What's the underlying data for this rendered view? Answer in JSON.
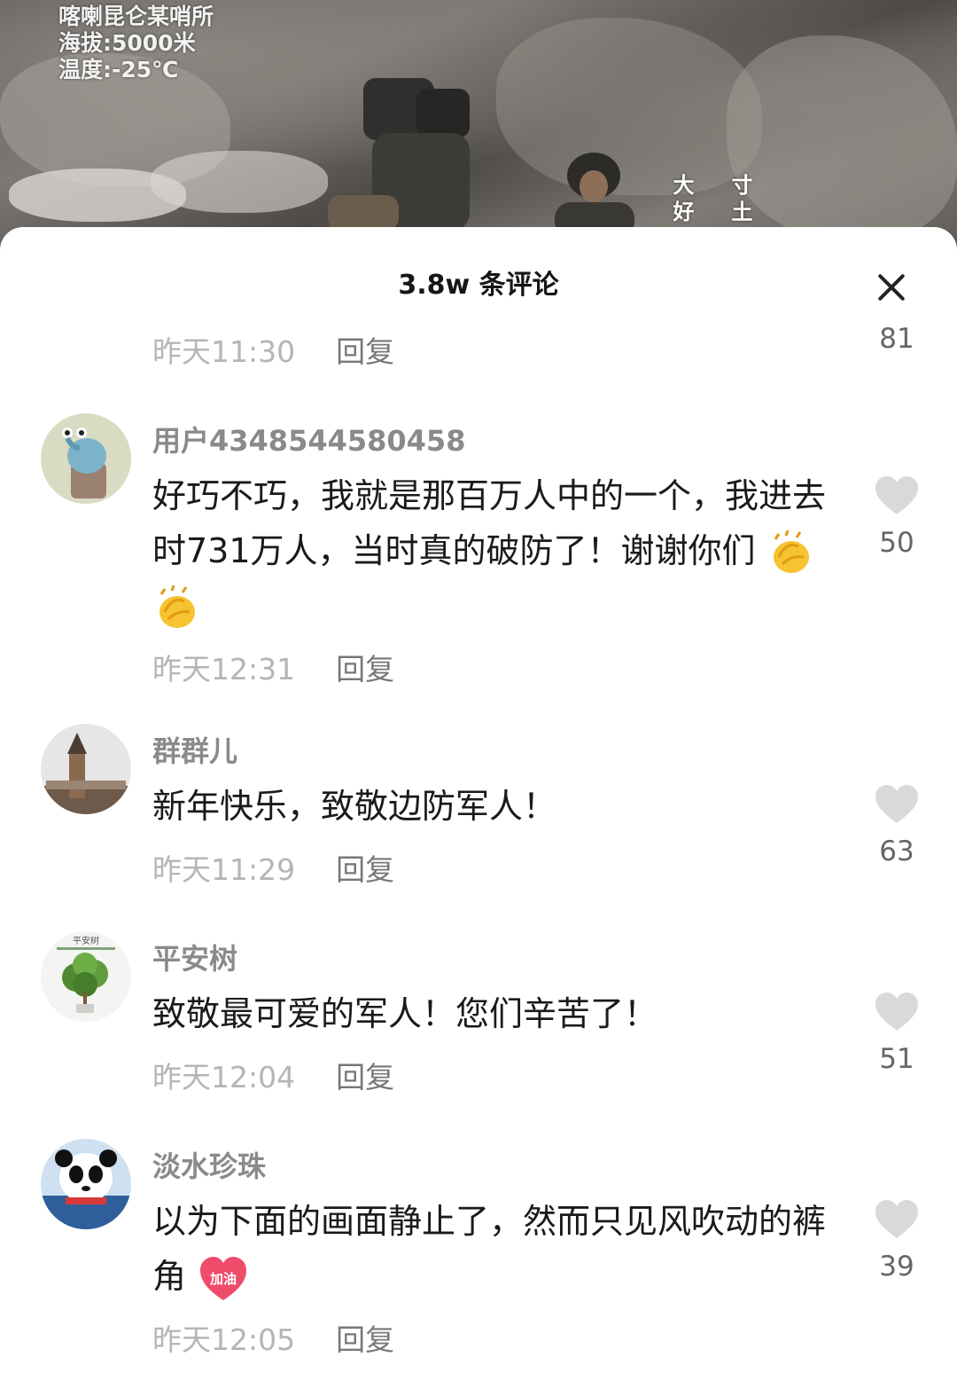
{
  "video_overlay": {
    "lines": [
      "喀喇昆仑某哨所",
      "海拔:5000米",
      "温度:-25℃"
    ],
    "caption_left": "大好",
    "caption_right": "寸土"
  },
  "sheet": {
    "title": "3.8w 条评论"
  },
  "top_partial": {
    "time": "昨天11:30",
    "reply_label": "回复",
    "likes": "81"
  },
  "comments": [
    {
      "username": "用户4348544580458",
      "text": "好巧不巧，我就是那百万人中的一个，我进去时731万人，当时真的破防了！谢谢你们",
      "emoji": [
        "clapping-hands-icon",
        "clapping-hands-icon"
      ],
      "time": "昨天12:31",
      "reply_label": "回复",
      "likes": "50"
    },
    {
      "username": "群群儿",
      "text": "新年快乐，致敬边防军人！",
      "time": "昨天11:29",
      "reply_label": "回复",
      "likes": "63"
    },
    {
      "username": "平安树",
      "avatar_text": "平安树",
      "text": "致敬最可爱的军人！您们辛苦了！",
      "time": "昨天12:04",
      "reply_label": "回复",
      "likes": "51"
    },
    {
      "username": "淡水珍珠",
      "text": "以为下面的画面静止了，然而只见风吹动的裤角",
      "emoji": [
        "jiayou-heart-icon"
      ],
      "emoji_text": "加油",
      "time": "昨天12:05",
      "reply_label": "回复",
      "likes": "39"
    }
  ],
  "colors": {
    "like_heart": "#d9d9d9",
    "meta_gray": "#b5b5b5",
    "username_gray": "#8a8a8a"
  }
}
